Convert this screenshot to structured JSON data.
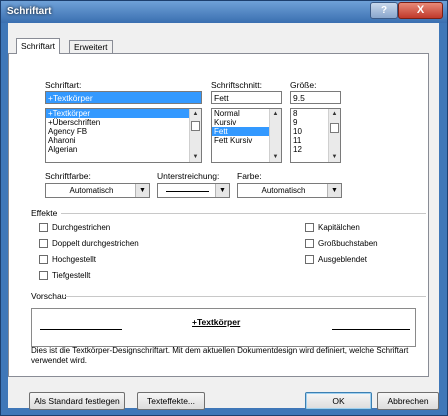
{
  "window": {
    "title": "Schriftart"
  },
  "titlebar_buttons": {
    "help": "?",
    "close": "X"
  },
  "tabs": [
    {
      "label": "Schriftart",
      "active": true
    },
    {
      "label": "Erweitert",
      "active": false
    }
  ],
  "font": {
    "label": "Schriftart:",
    "value": "+Textkörper",
    "items": [
      "+Textkörper",
      "+Überschriften",
      "Agency FB",
      "Aharoni",
      "Algerian"
    ],
    "selected_index": 0
  },
  "style": {
    "label": "Schriftschnitt:",
    "value": "Fett",
    "items": [
      "Normal",
      "Kursiv",
      "Fett",
      "Fett Kursiv"
    ],
    "selected_index": 2
  },
  "size": {
    "label": "Größe:",
    "value": "9.5",
    "items": [
      "8",
      "9",
      "10",
      "11",
      "12"
    ]
  },
  "font_color": {
    "label": "Schriftfarbe:",
    "value": "Automatisch"
  },
  "underline": {
    "label": "Unterstreichung:",
    "value": ""
  },
  "underline_color": {
    "label": "Farbe:",
    "value": "Automatisch"
  },
  "effects": {
    "title": "Effekte",
    "left": [
      "Durchgestrichen",
      "Doppelt durchgestrichen",
      "Hochgestellt",
      "Tiefgestellt"
    ],
    "right": [
      "Kapitälchen",
      "Großbuchstaben",
      "Ausgeblendet"
    ]
  },
  "preview": {
    "title": "Vorschau",
    "sample": "+Textkörper",
    "description": "Dies ist die Textkörper-Designschriftart. Mit dem aktuellen Dokumentdesign wird definiert, welche Schriftart verwendet wird."
  },
  "buttons": {
    "set_default": "Als Standard festlegen",
    "text_effects": "Texteffekte...",
    "ok": "OK",
    "cancel": "Abbrechen"
  }
}
